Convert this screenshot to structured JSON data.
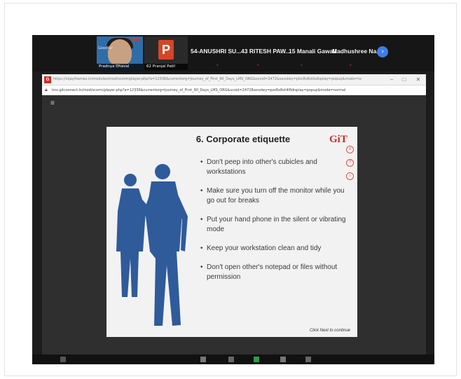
{
  "participants": {
    "video_tile": {
      "caption": "Pradnya Dhaval",
      "small_text": "GoodKal",
      "corner_logo": "GiT"
    },
    "ppt_tile": {
      "letter": "P",
      "caption": "62 Pranjal Patil"
    },
    "names": [
      "54-ANUSHRI SU...",
      "43 RITESH PAW...",
      "15 Manali Gawali",
      "Madhushree Na..."
    ],
    "next_icon": "chevron-right-icon"
  },
  "browser": {
    "title": "https://vijaythemes.in/modules/mod/scorm/player.php?a=12336&currentorg=Journey_of_First_90_Days_LMS_ORG&scoid=2472&sesskey=pIsc8x8ot&display=popup&mode=normal - Google Chrome",
    "url": "lms.gitconnect.in/mod/scorm/player.php?a=12336&currentorg=Journey_of_First_90_Days_LMS_ORG&scoid=24728sesskey=pzs8x8ot4l8display=popup&mode=normal",
    "window_controls": [
      "–",
      "□",
      "✕"
    ]
  },
  "slide": {
    "title": "6. Corporate etiquette",
    "logo_text": "GiT",
    "bullets": [
      "Don't peep into other's cubicles and workstations",
      "Make sure you turn off the monitor while you go out for breaks",
      "Put your hand phone in the silent or vibrating mode",
      "Keep your workstation clean and tidy",
      "Don't open other's notepad or files without permission"
    ],
    "continue_text": "Click Next to continue",
    "side_icons": [
      "menu-icon",
      "help-icon",
      "resources-icon"
    ]
  },
  "colors": {
    "silhouette": "#2f5b9a",
    "accent_red": "#e05243",
    "zoom_blue": "#3f7ee8"
  }
}
